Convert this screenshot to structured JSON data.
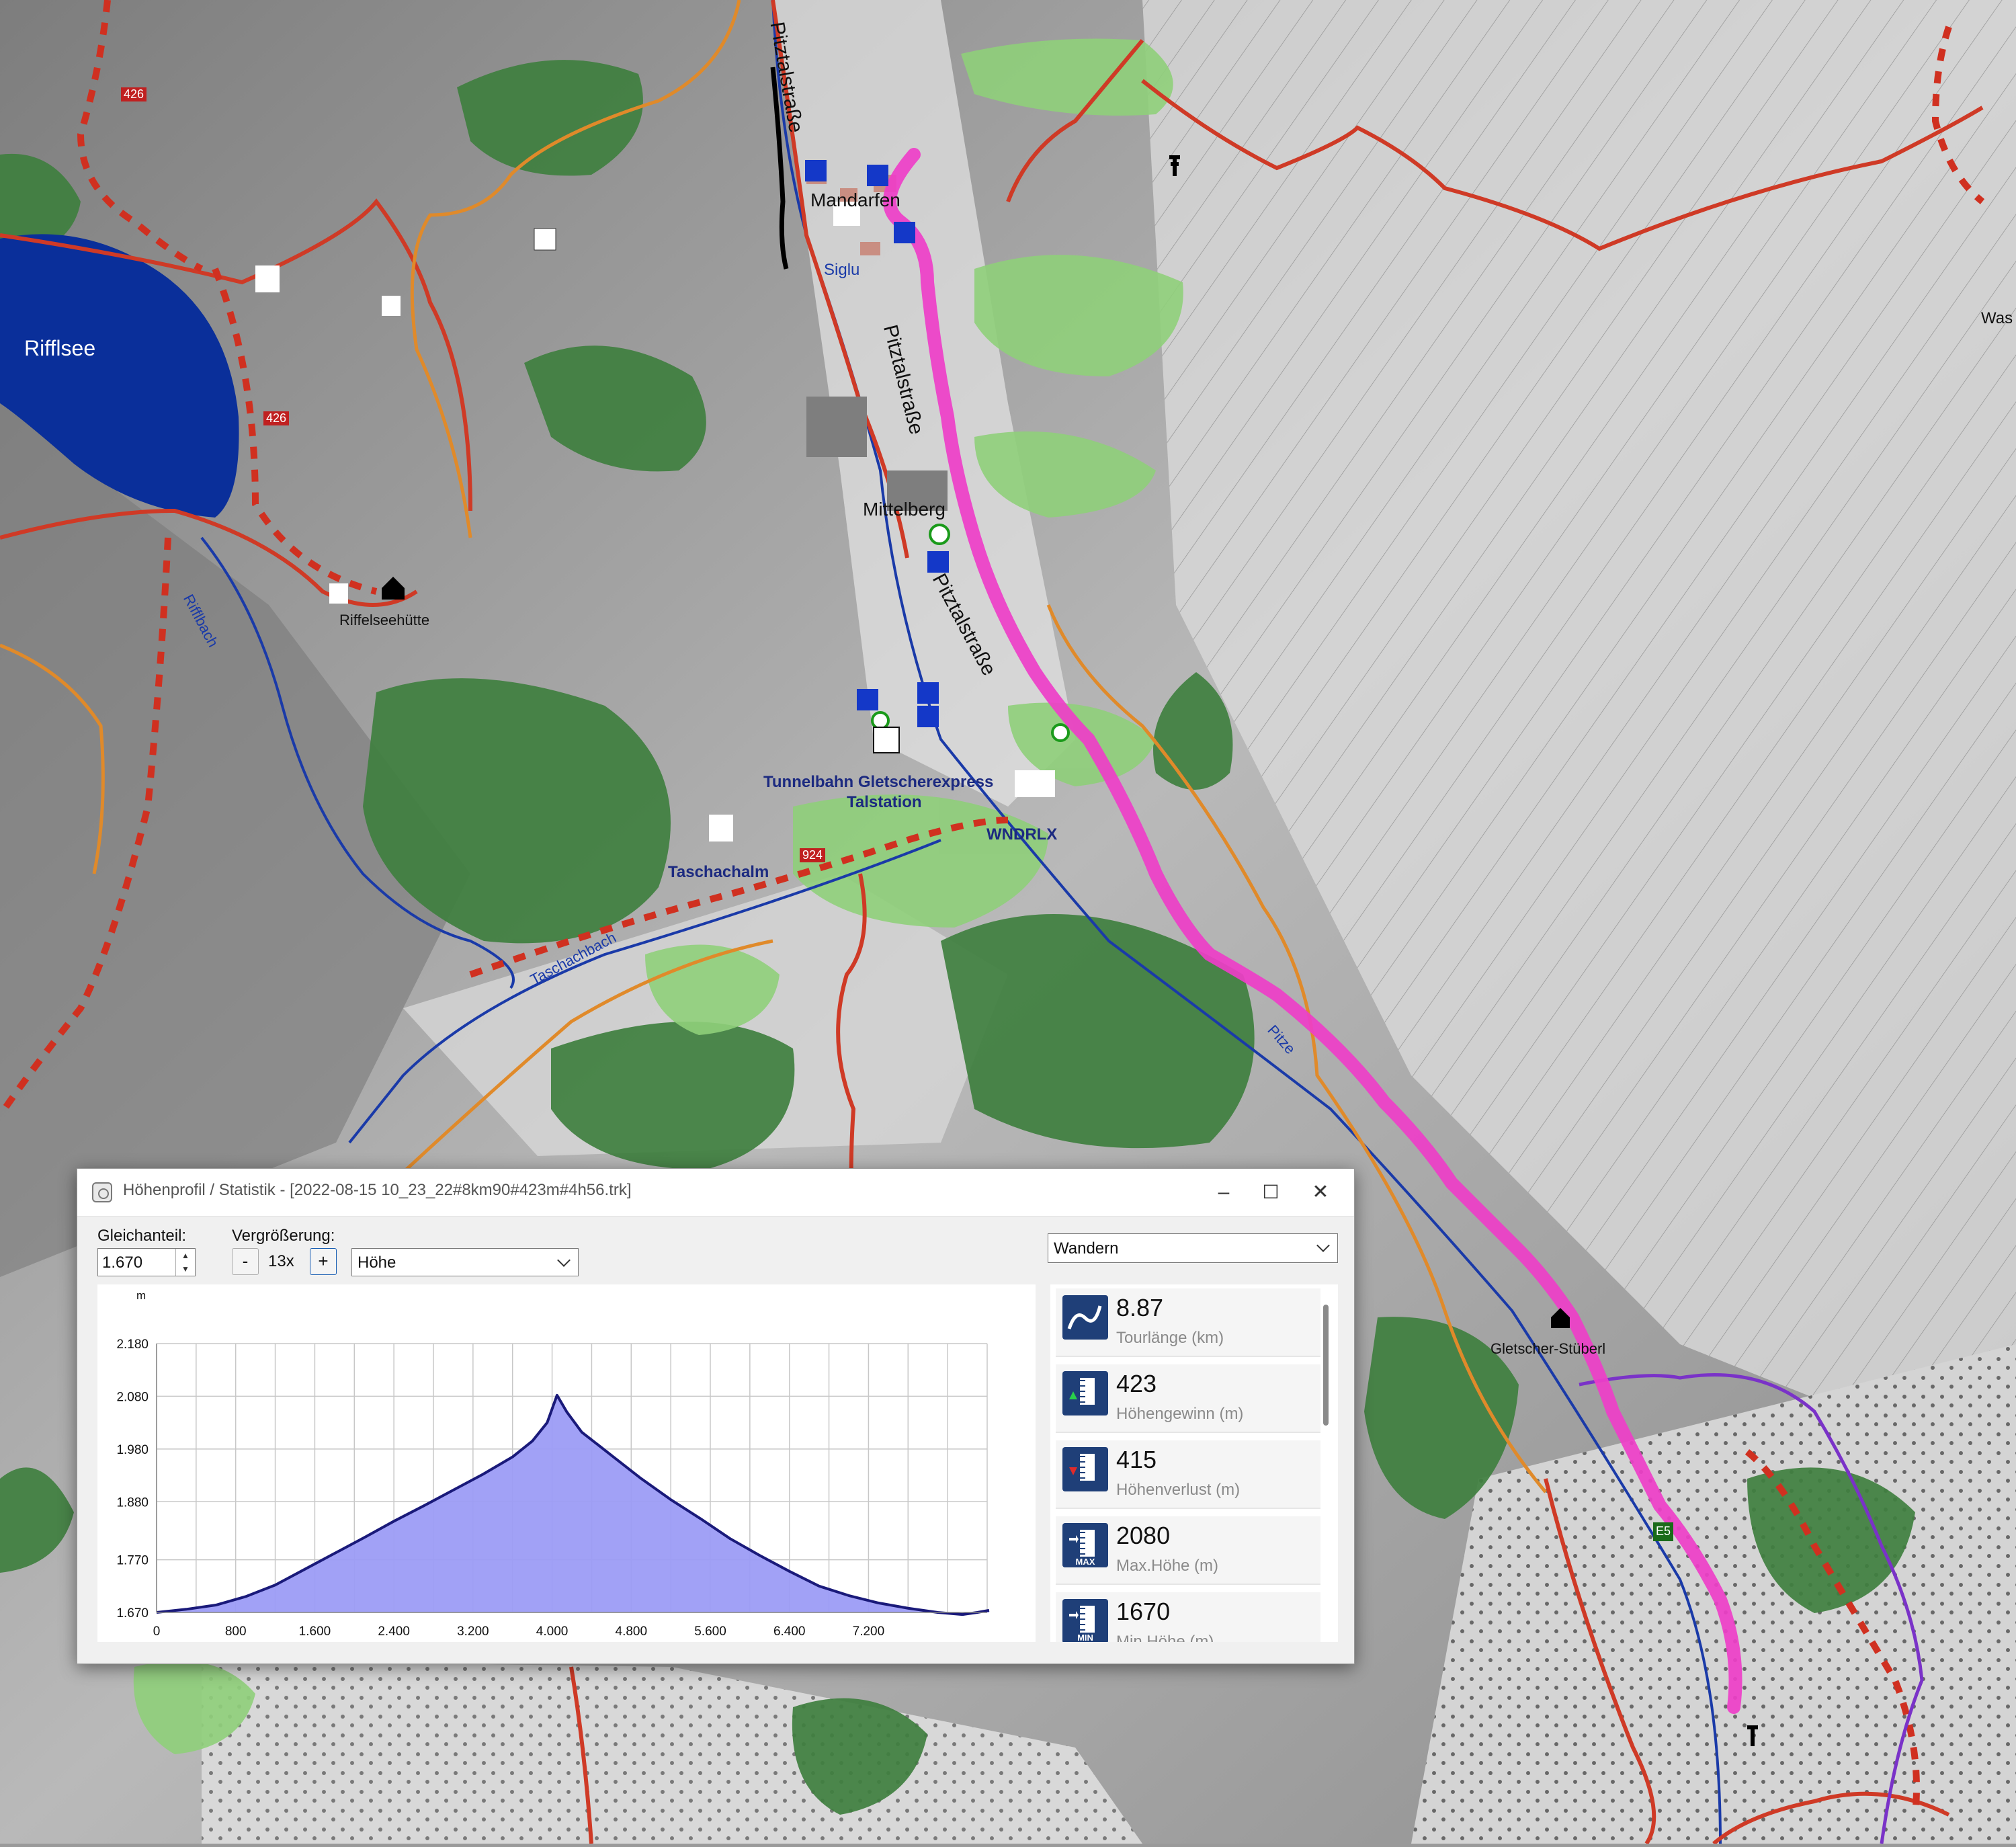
{
  "map": {
    "labels": {
      "rifflsee": "Rifflsee",
      "riffelseehuette": "Riffelseehütte",
      "rifflbach": "Rifflbach",
      "mandarfen": "Mandarfen",
      "siglu": "Siglu",
      "pitztalstrasse": "Pitztalstraße",
      "mittelberg": "Mittelberg",
      "tunnelbahn1": "Tunnelbahn Gletscherexpress",
      "tunnelbahn2": "Talstation",
      "wndrlx": "WNDRLX",
      "taschachalm": "Taschachalm",
      "taschachbach": "Taschachbach",
      "gletscherstueberl": "Gletscher-Stüberl",
      "pitze": "Pitze",
      "was": "Was",
      "trail426a": "426",
      "trail426b": "426",
      "trail924": "924",
      "e5": "E5"
    },
    "colors": {
      "track": "#ee3ec8",
      "road_red": "#cf3a26",
      "orange": "#e08a2a",
      "water": "#0a2f9a",
      "forest": "#3f7f3f",
      "meadow": "#8fcf7a"
    }
  },
  "window": {
    "title": "Höhenprofil / Statistik - [2022-08-15 10_23_22#8km90#423m#4h56.trk]",
    "minimize": "–",
    "maximize": "☐",
    "close": "✕",
    "gleichanteil_label": "Gleichanteil:",
    "gleichanteil_value": "1.670",
    "vergroesserung_label": "Vergrößerung:",
    "zoom_minus": "-",
    "zoom_value": "13x",
    "zoom_plus": "+",
    "profile_select": "Höhe",
    "activity_select": "Wandern"
  },
  "chart_data": {
    "type": "area",
    "y_unit": "m",
    "x_unit": "m",
    "ylim": [
      1670,
      2180
    ],
    "xlim": [
      0,
      8400
    ],
    "y_ticks": [
      "1.670",
      "1.770",
      "1.880",
      "1.980",
      "2.080",
      "2.180"
    ],
    "x_ticks": [
      "0",
      "800",
      "1.600",
      "2.400",
      "3.200",
      "4.000",
      "4.800",
      "5.600",
      "6.400",
      "7.200"
    ],
    "grid": true,
    "series": [
      {
        "x": [
          0,
          300,
          600,
          900,
          1200,
          1500,
          1800,
          2100,
          2400,
          2700,
          3000,
          3300,
          3600,
          3800,
          3950,
          4050,
          4150,
          4300,
          4600,
          4900,
          5200,
          5500,
          5800,
          6100,
          6400,
          6700,
          7000,
          7300,
          7600,
          7900,
          8150,
          8300,
          8420
        ],
        "y": [
          1670,
          1676,
          1684,
          1700,
          1722,
          1752,
          1782,
          1812,
          1843,
          1872,
          1902,
          1932,
          1965,
          1995,
          2030,
          2082,
          2050,
          2012,
          1968,
          1924,
          1884,
          1848,
          1810,
          1778,
          1748,
          1720,
          1702,
          1688,
          1678,
          1670,
          1666,
          1670,
          1674
        ]
      }
    ]
  },
  "stats": [
    {
      "value": "8.87",
      "name": "Tourlänge (km)",
      "icon": "route-icon"
    },
    {
      "value": "423",
      "name": "Höhengewinn (m)",
      "icon": "elevation-gain-icon"
    },
    {
      "value": "415",
      "name": "Höhenverlust (m)",
      "icon": "elevation-loss-icon"
    },
    {
      "value": "2080",
      "name": "Max.Höhe (m)",
      "icon": "max-height-icon",
      "badge": "MAX"
    },
    {
      "value": "1670",
      "name": "Min.Höhe (m)",
      "icon": "min-height-icon",
      "badge": "MIN"
    }
  ]
}
